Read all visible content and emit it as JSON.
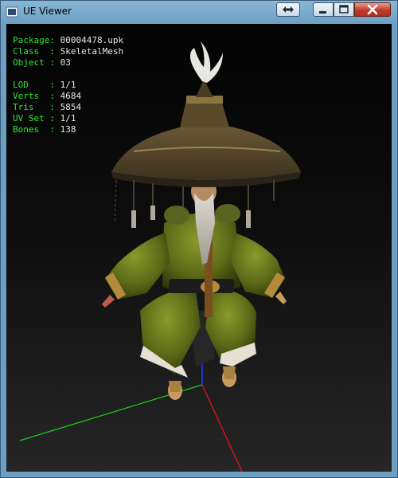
{
  "window": {
    "title": "UE Viewer"
  },
  "info": {
    "block1": [
      {
        "key": "Package",
        "value": "00004478.upk"
      },
      {
        "key": "Class  ",
        "value": "SkeletalMesh"
      },
      {
        "key": "Object ",
        "value": "03"
      }
    ],
    "block2": [
      {
        "key": "LOD    ",
        "value": "1/1"
      },
      {
        "key": "Verts  ",
        "value": "4684"
      },
      {
        "key": "Tris   ",
        "value": "5854"
      },
      {
        "key": "UV Set ",
        "value": "1/1"
      },
      {
        "key": "Bones  ",
        "value": "138"
      }
    ]
  },
  "colors": {
    "label": "#2ee82e",
    "value": "#e8e8e8",
    "axis_x": "#e01010",
    "axis_y": "#18d018",
    "axis_z": "#2040ff"
  },
  "icons": {
    "swap": "double-arrow-icon",
    "minimize": "minimize-icon",
    "maximize": "maximize-icon",
    "close": "close-icon"
  }
}
